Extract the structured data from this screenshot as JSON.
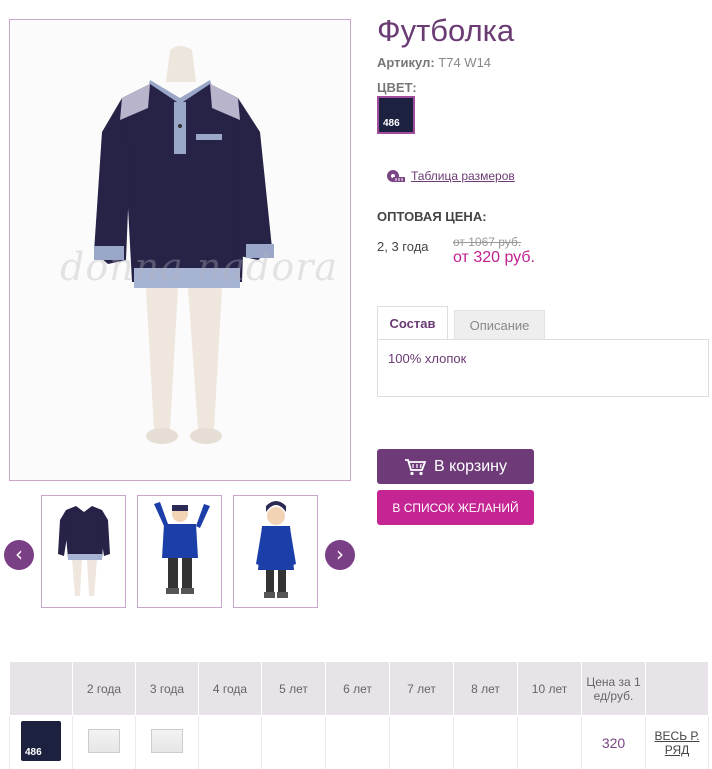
{
  "product": {
    "title": "Футболка",
    "article_label": "Артикул:",
    "article_value": "T74 W14",
    "color_label": "ЦВЕТ:",
    "color_code": "486",
    "color_hex": "#1c2140",
    "size_table_link": "Таблица размеров",
    "watermark": "donna nadora"
  },
  "pricing": {
    "wholesale_label": "ОПТОВАЯ ЦЕНА:",
    "ages": "2, 3 года",
    "old_price": "от 1067 руб.",
    "new_price": "от 320 руб."
  },
  "tabs": [
    {
      "label": "Состав",
      "active": true
    },
    {
      "label": "Описание",
      "active": false
    }
  ],
  "tab_content": "100% хлопок",
  "buttons": {
    "cart": "В корзину",
    "wishlist": "В СПИСОК ЖЕЛАНИЙ"
  },
  "gallery": {
    "prev_icon": "chevron-left-icon",
    "next_icon": "chevron-right-icon"
  },
  "size_grid": {
    "headers": [
      "",
      "2 года",
      "3 года",
      "4 года",
      "5 лет",
      "6 лет",
      "7 лет",
      "8 лет",
      "10 лет",
      "Цена за 1 ед/руб.",
      ""
    ],
    "row": {
      "color_code": "486",
      "price": "320",
      "link": "ВЕСЬ Р. РЯД"
    }
  },
  "colors": {
    "accent": "#6b3b74",
    "pink": "#c42592",
    "navy": "#1c2140"
  }
}
